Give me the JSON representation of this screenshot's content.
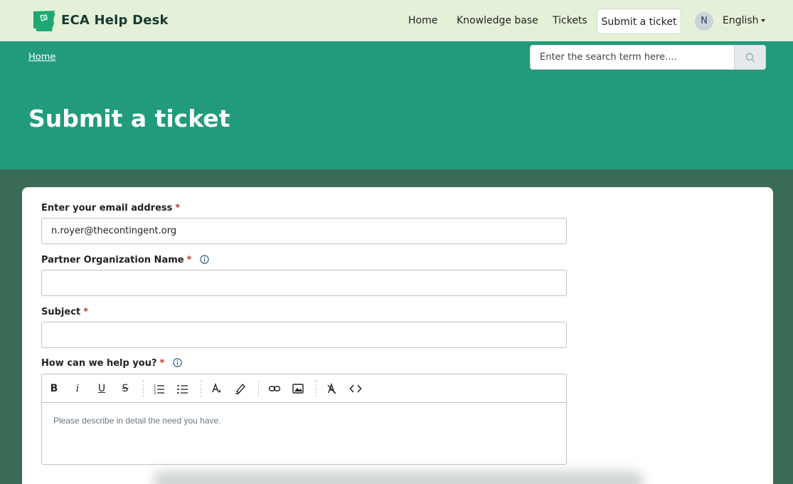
{
  "header": {
    "brand": "ECA Help Desk",
    "nav": [
      "Home",
      "Knowledge base",
      "Tickets",
      "Submit a ticket"
    ],
    "avatar_initial": "N",
    "language": "English"
  },
  "hero": {
    "breadcrumb": "Home",
    "search_placeholder": "Enter the search term here....",
    "title": "Submit a ticket"
  },
  "form": {
    "email_label": "Enter your email address",
    "email_value": "n.royer@thecontingent.org",
    "org_label": "Partner Organization Name",
    "org_value": "",
    "subject_label": "Subject",
    "subject_value": "",
    "help_label": "How can we help you?",
    "required_mark": "*",
    "editor_placeholder": "Please describe in detail the need you have."
  },
  "colors": {
    "header_bg": "#e4f1d8",
    "hero_bg": "#219b7c",
    "page_bg": "#3a6b57",
    "brand_text": "#173a30",
    "required": "#c0392b"
  },
  "icons": {
    "logo": "arkansas-state-logo-icon",
    "search": "search-icon",
    "info": "info-circle-icon",
    "toolbar": [
      "bold-icon",
      "italic-icon",
      "underline-icon",
      "strikethrough-icon",
      "ordered-list-icon",
      "unordered-list-icon",
      "text-color-icon",
      "highlight-icon",
      "link-icon",
      "image-icon",
      "clear-format-icon",
      "code-icon"
    ]
  }
}
